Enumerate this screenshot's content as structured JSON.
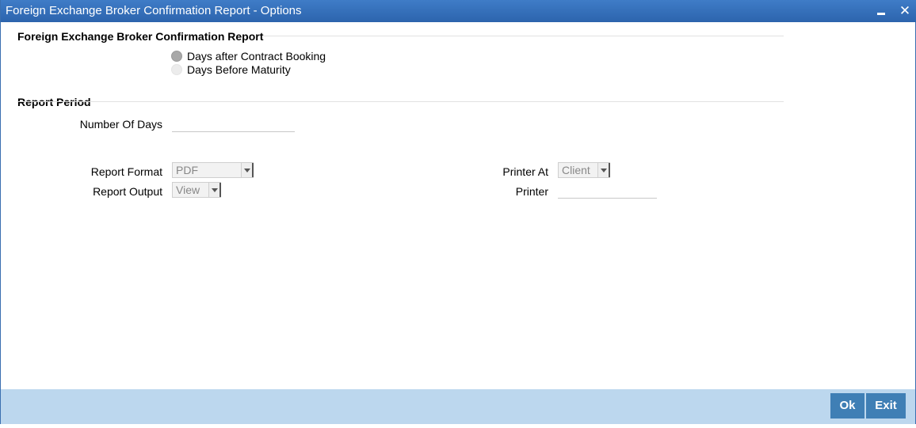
{
  "window": {
    "title": "Foreign Exchange Broker Confirmation Report - Options",
    "minimize_icon": "minimize-icon",
    "close_icon": "close-icon",
    "close_glyph": "✕"
  },
  "section_report": {
    "title": "Foreign Exchange Broker Confirmation Report",
    "options": [
      {
        "label": "Days after Contract Booking",
        "checked": true
      },
      {
        "label": "Days Before Maturity",
        "checked": false
      }
    ]
  },
  "section_period": {
    "title": "Report Period",
    "number_of_days_label": "Number Of Days",
    "number_of_days_value": ""
  },
  "report_format": {
    "label": "Report Format",
    "value": "PDF"
  },
  "report_output": {
    "label": "Report Output",
    "value": "View"
  },
  "printer_at": {
    "label": "Printer At",
    "value": "Client"
  },
  "printer": {
    "label": "Printer",
    "value": ""
  },
  "footer": {
    "ok_label": "Ok",
    "exit_label": "Exit"
  },
  "colors": {
    "title_bar": "#2c64ad",
    "footer": "#bcd7ee",
    "button": "#3f7fb5"
  }
}
